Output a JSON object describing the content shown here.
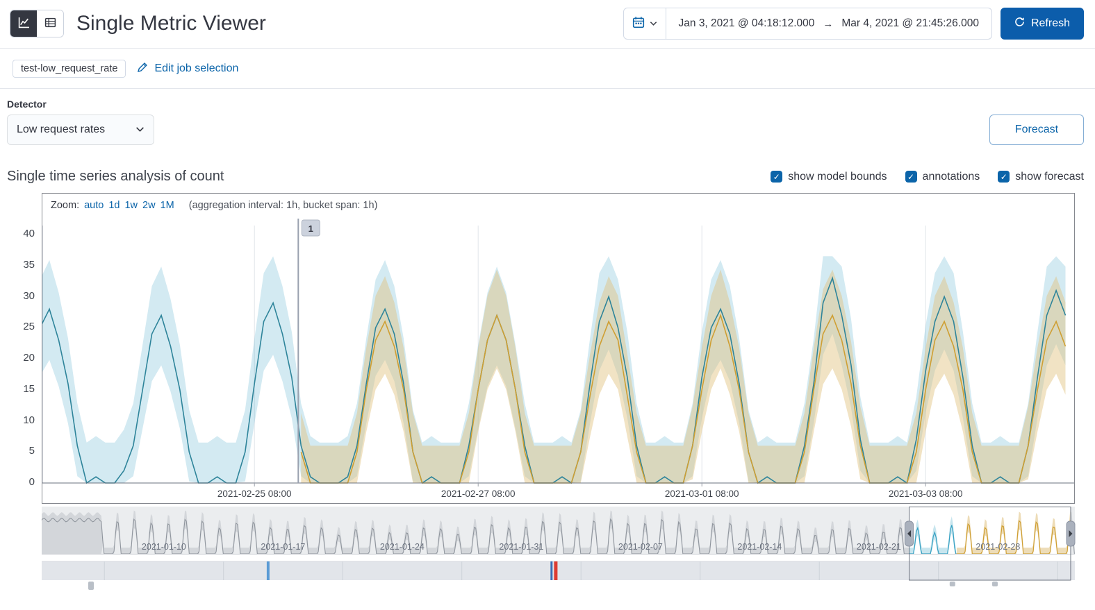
{
  "header": {
    "title": "Single Metric Viewer",
    "view_toggle": [
      {
        "name": "chart",
        "selected": true
      },
      {
        "name": "table",
        "selected": false
      }
    ],
    "datepicker": {
      "start": "Jan 3, 2021 @ 04:18:12.000",
      "arrow": "→",
      "end": "Mar 4, 2021 @ 21:45:26.000"
    },
    "refresh_label": "Refresh"
  },
  "job_bar": {
    "badge": "test-low_request_rate",
    "edit_link": "Edit job selection"
  },
  "detector": {
    "label": "Detector",
    "selected_value": "Low request rates",
    "forecast_button": "Forecast"
  },
  "series_header": {
    "title": "Single time series analysis of count",
    "checkboxes": [
      {
        "label": "show model bounds",
        "checked": true
      },
      {
        "label": "annotations",
        "checked": true
      },
      {
        "label": "show forecast",
        "checked": true
      }
    ]
  },
  "chart_data": {
    "type": "line",
    "title": "Single time series analysis of count",
    "zoom": {
      "label": "Zoom:",
      "options": [
        "auto",
        "1d",
        "1w",
        "2w",
        "1M"
      ],
      "suffix": "(aggregation interval: 1h, bucket span: 1h)"
    },
    "main": {
      "ylim": [
        0,
        40
      ],
      "yticks": [
        0,
        5,
        10,
        15,
        20,
        25,
        30,
        35,
        40
      ],
      "xticks": [
        {
          "t": 46,
          "label": "2021-02-25 08:00"
        },
        {
          "t": 94,
          "label": "2021-02-27 08:00"
        },
        {
          "t": 142,
          "label": "2021-03-01 08:00"
        },
        {
          "t": 190,
          "label": "2021-03-03 08:00"
        }
      ],
      "domain_hours": [
        0.5,
        221.9
      ],
      "annotation": {
        "t": 55.4,
        "label": "1"
      },
      "forecast_start_t": 55.4,
      "actual": {
        "t0": 0,
        "t_step": 2,
        "values": [
          25,
          28,
          23,
          16,
          6,
          0,
          1,
          0,
          0,
          2,
          6,
          15,
          24,
          27,
          22,
          15,
          5,
          0,
          0,
          1,
          0,
          0,
          5,
          16,
          26,
          29,
          24,
          17,
          6,
          1,
          0,
          0,
          0,
          1,
          6,
          16,
          25,
          28,
          24,
          16,
          5,
          0,
          1,
          0,
          0,
          0,
          6,
          15,
          23,
          27,
          23,
          15,
          6,
          0,
          0,
          0,
          1,
          0,
          5,
          16,
          26,
          30,
          25,
          17,
          6,
          0,
          0,
          1,
          0,
          0,
          6,
          17,
          25,
          28,
          24,
          16,
          5,
          0,
          1,
          0,
          0,
          0,
          6,
          16,
          29,
          33,
          27,
          19,
          7,
          0,
          0,
          0,
          1,
          0,
          7,
          18,
          26,
          30,
          26,
          17,
          6,
          0,
          0,
          1,
          0,
          0,
          6,
          17,
          27,
          31,
          27
        ]
      },
      "forecast": {
        "t0": 56,
        "t_step": 2,
        "values": [
          5,
          0,
          0,
          0,
          0,
          0,
          5,
          15,
          23,
          26,
          22,
          15,
          5,
          0,
          0,
          0,
          0,
          0,
          5,
          15,
          23,
          27,
          23,
          15,
          5,
          0,
          0,
          0,
          0,
          0,
          5,
          14,
          22,
          26,
          23,
          14,
          5,
          0,
          0,
          0,
          0,
          0,
          6,
          15,
          23,
          27,
          22,
          15,
          5,
          0,
          0,
          0,
          0,
          0,
          5,
          15,
          24,
          27,
          23,
          16,
          6,
          0,
          0,
          0,
          0,
          0,
          5,
          15,
          23,
          26,
          22,
          15,
          5,
          0,
          0,
          0,
          0,
          0,
          6,
          15,
          23,
          26,
          22
        ]
      },
      "model_bounds_rule": {
        "upper": "1.05*v+6.5",
        "lower": "0.85*v-4"
      },
      "forecast_bounds_rule": {
        "upper": "1.05*v+6",
        "lower": "0.85*v-4.5"
      }
    },
    "context": {
      "xticks": [
        {
          "day": 7.18,
          "label": "2021-01-10"
        },
        {
          "day": 14.18,
          "label": "2021-01-17"
        },
        {
          "day": 21.18,
          "label": "2021-01-24"
        },
        {
          "day": 28.18,
          "label": "2021-01-31"
        },
        {
          "day": 35.18,
          "label": "2021-02-07"
        },
        {
          "day": 42.18,
          "label": "2021-02-14"
        },
        {
          "day": 49.18,
          "label": "2021-02-21"
        },
        {
          "day": 56.18,
          "label": "2021-02-28"
        }
      ],
      "selection_days": [
        50.96,
        60.45
      ],
      "forecast_start_day": 53.75,
      "annotation_markers": [
        {
          "day": 13.3,
          "color": "#5a9bd5",
          "w": 4
        },
        {
          "day": 29.95,
          "color": "#3d6fb5",
          "w": 3
        },
        {
          "day": 30.2,
          "color": "#dd3c32",
          "w": 5
        }
      ],
      "bottom_ticks": [
        {
          "day": 2.9,
          "w": 8,
          "h": 12
        },
        {
          "day": 53.5,
          "w": 8,
          "h": 7
        },
        {
          "day": 56.0,
          "w": 8,
          "h": 7
        }
      ]
    }
  },
  "colors": {
    "accent_blue": "#0b64a9",
    "refresh_bg": "#0c5dab",
    "actual_line": "#2e849a",
    "forecast_line": "#cf9f33",
    "model_band": "#35a0c2",
    "forecast_band": "#dfc07c",
    "annotation_red": "#dd3c32",
    "annotation_blue": "#5a9bd5"
  }
}
